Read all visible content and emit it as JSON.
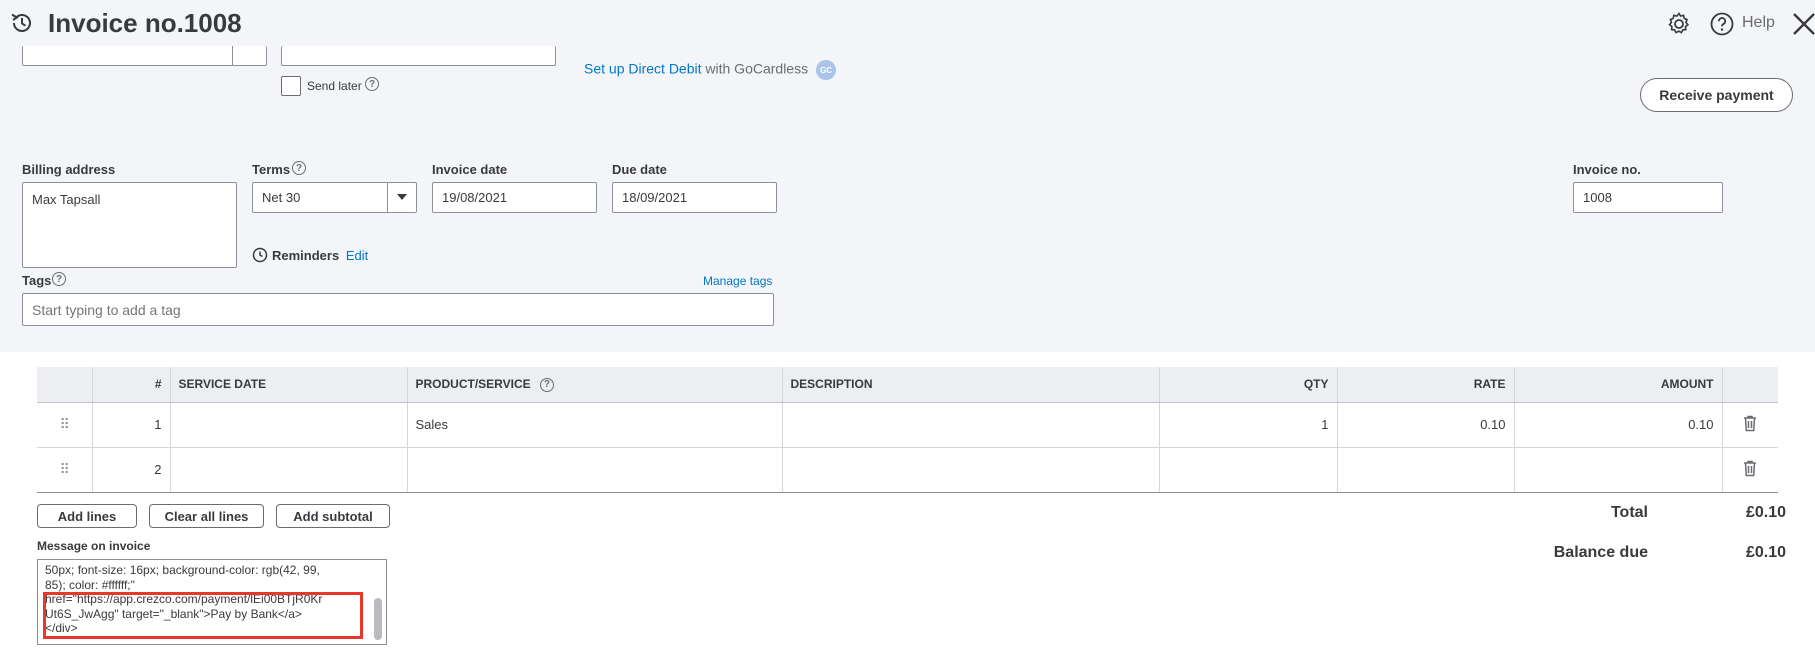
{
  "header": {
    "title": "Invoice no.1008",
    "help_label": "Help"
  },
  "send": {
    "send_later_label": "Send later",
    "direct_debit_link": "Set up Direct Debit",
    "direct_debit_suffix": "with GoCardless",
    "gocardless_badge": "GC",
    "receive_payment_label": "Receive payment"
  },
  "billing": {
    "label": "Billing address",
    "value": "Max Tapsall"
  },
  "terms": {
    "label": "Terms",
    "value": "Net 30"
  },
  "invoice_date": {
    "label": "Invoice date",
    "value": "19/08/2021"
  },
  "due_date": {
    "label": "Due date",
    "value": "18/09/2021"
  },
  "invoice_no": {
    "label": "Invoice no.",
    "value": "1008"
  },
  "reminders": {
    "label": "Reminders",
    "edit_label": "Edit"
  },
  "tags": {
    "label": "Tags",
    "manage_label": "Manage tags",
    "placeholder": "Start typing to add a tag"
  },
  "table": {
    "headers": [
      "",
      "#",
      "SERVICE DATE",
      "PRODUCT/SERVICE",
      "DESCRIPTION",
      "QTY",
      "RATE",
      "AMOUNT",
      ""
    ],
    "rows": [
      {
        "num": "1",
        "service_date": "",
        "product": "Sales",
        "description": "",
        "qty": "1",
        "rate": "0.10",
        "amount": "0.10"
      },
      {
        "num": "2",
        "service_date": "",
        "product": "",
        "description": "",
        "qty": "",
        "rate": "",
        "amount": ""
      }
    ]
  },
  "actions": {
    "add_lines": "Add lines",
    "clear_all_lines": "Clear all lines",
    "add_subtotal": "Add subtotal"
  },
  "totals": {
    "total_label": "Total",
    "total_value": "£0.10",
    "balance_label": "Balance due",
    "balance_value": "£0.10"
  },
  "message": {
    "label": "Message on invoice",
    "text": "50px; font-size: 16px; background-color: rgb(42, 99,\n85); color: #ffffff;\"\nhref=\"https://app.crezco.com/payment/lEi00BTjR0Kr\nUt6S_JwAgg\" target=\"_blank\">Pay by Bank</a>\n</div>"
  },
  "colors": {
    "link": "#0077c5",
    "highlight_border": "#e8382b",
    "top_background": "#f4f5f8"
  }
}
